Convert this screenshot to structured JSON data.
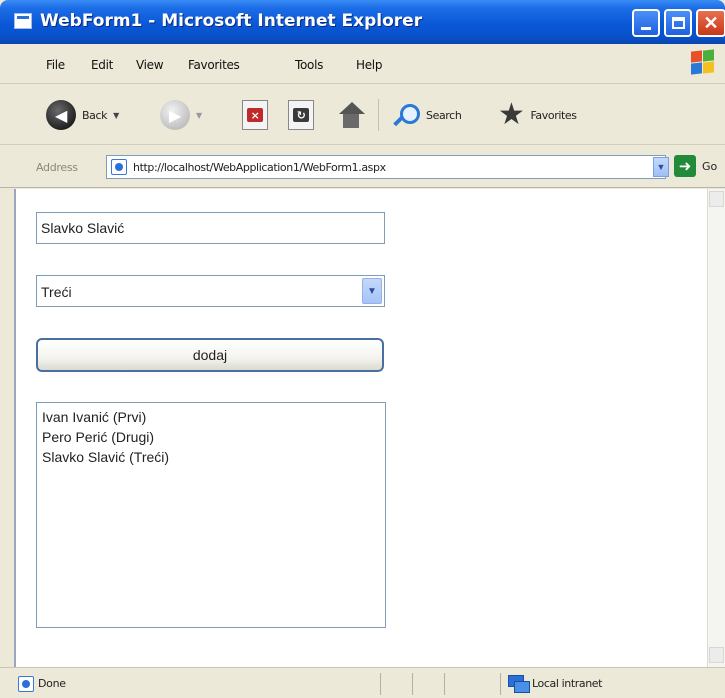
{
  "window": {
    "title": "WebForm1 - Microsoft Internet Explorer"
  },
  "menu": {
    "items": [
      "File",
      "Edit",
      "View",
      "Favorites",
      "Tools",
      "Help"
    ]
  },
  "toolbar": {
    "back_label": "Back",
    "search_label": "Search",
    "favorites_label": "Favorites"
  },
  "address": {
    "label": "Address",
    "url": "http://localhost/WebApplication1/WebForm1.aspx",
    "go_label": "Go"
  },
  "form": {
    "name_value": "Slavko Slavić",
    "select_value": "Treći",
    "button_label": "dodaj",
    "list_items": [
      "Ivan Ivanić (Prvi)",
      "Pero Perić (Drugi)",
      "Slavko Slavić (Treći)"
    ]
  },
  "status": {
    "text": "Done",
    "zone": "Local intranet"
  },
  "colors": {
    "titlebar": "#0a58d8",
    "chrome": "#ece9d8",
    "field_border": "#7f9db9",
    "button_border": "#4a6fa3"
  }
}
